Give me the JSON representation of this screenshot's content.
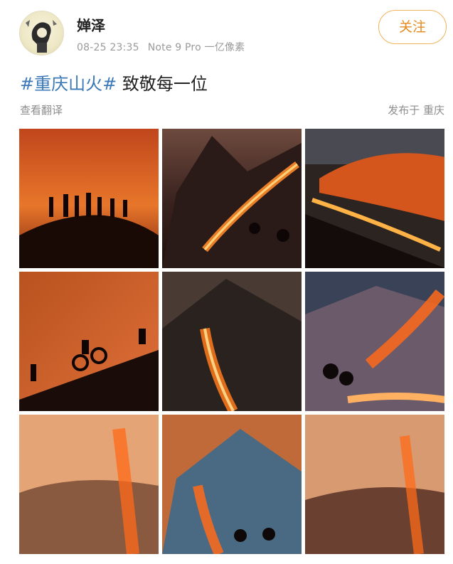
{
  "user": {
    "name": "婵泽",
    "timestamp": "08-25 23:35",
    "device": "Note 9 Pro 一亿像素",
    "verified_badge": "V"
  },
  "follow_button": "关注",
  "post": {
    "topic": "#重庆山火#",
    "text": " 致敬每一位"
  },
  "translate_link": "查看翻译",
  "location": "发布于 重庆",
  "colors": {
    "accent": "#e48a1d",
    "topic_link": "#3b78b8",
    "meta_gray": "#9a9a9a"
  },
  "images": [
    {
      "label": "silhouettes-on-hill-fire"
    },
    {
      "label": "mountain-fire-motorcyclists"
    },
    {
      "label": "burning-hillside-aerial"
    },
    {
      "label": "dirt-bike-rider-fire-slope"
    },
    {
      "label": "valley-fire-road"
    },
    {
      "label": "motorcycles-night-fire"
    },
    {
      "label": "smoky-valley-fire-line"
    },
    {
      "label": "blue-mountain-fire-riders"
    },
    {
      "label": "hazy-valley-fire"
    }
  ]
}
